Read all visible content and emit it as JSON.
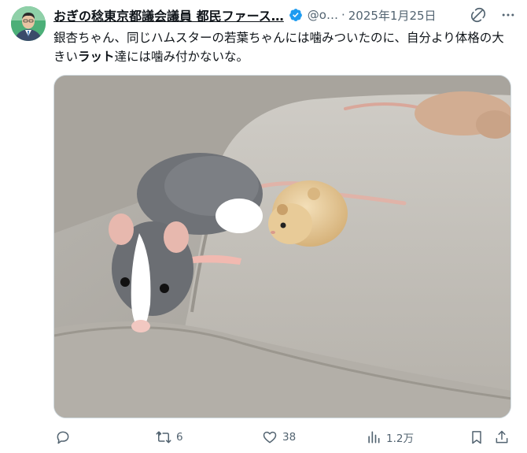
{
  "author": {
    "display_name": "おぎの稔東京都議会議員 都民ファース…",
    "handle": "@o…",
    "date": "2025年1月25日"
  },
  "post": {
    "text_before": "銀杏ちゃん、同じハムスターの若葉ちゃんには噛みついたのに、自分より体格の大きい",
    "text_bold": "ラット",
    "text_after": "達には噛み付かないな。"
  },
  "media": {
    "description_icon": "photo"
  },
  "actions": {
    "reply_count": "",
    "repost_count": "6",
    "like_count": "38",
    "views_count": "1.2万"
  },
  "colors": {
    "verified": "#1d9bf0",
    "muted": "#536471"
  }
}
